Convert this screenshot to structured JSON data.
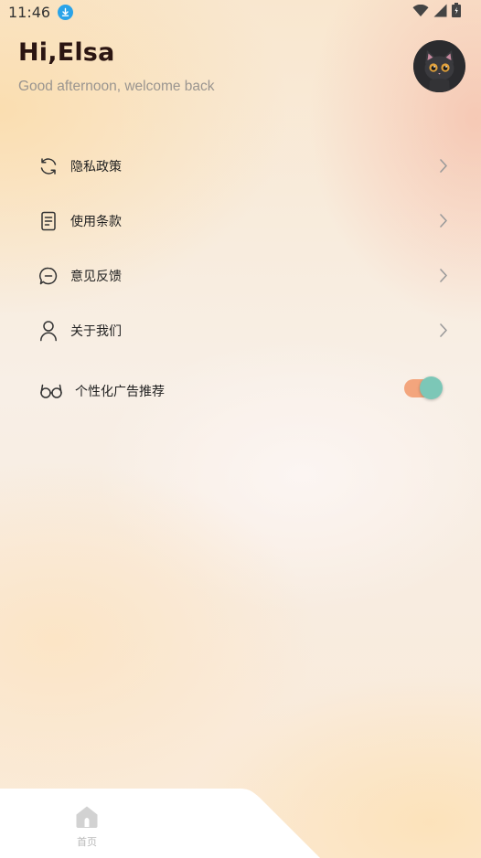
{
  "status_bar": {
    "time": "11:46",
    "icons": [
      "download-icon",
      "wifi-icon",
      "signal-icon",
      "battery-icon"
    ]
  },
  "header": {
    "greeting": "Hi,Elsa",
    "subtitle": "Good afternoon, welcome back",
    "avatar": "black-cat-avatar"
  },
  "menu": {
    "items": [
      {
        "label": "隐私政策",
        "icon": "refresh-icon"
      },
      {
        "label": "使用条款",
        "icon": "document-icon"
      },
      {
        "label": "意见反馈",
        "icon": "chat-bubble-icon"
      },
      {
        "label": "关于我们",
        "icon": "person-icon"
      }
    ],
    "ad_toggle": {
      "label": "个性化广告推荐",
      "icon": "glasses-icon",
      "enabled": true
    }
  },
  "bottom_nav": {
    "home_label": "首页",
    "home_icon": "home-icon"
  },
  "colors": {
    "toggle_track": "#f3a57d",
    "toggle_knob": "#7cc7b7",
    "download_badge": "#2aa3e8"
  }
}
